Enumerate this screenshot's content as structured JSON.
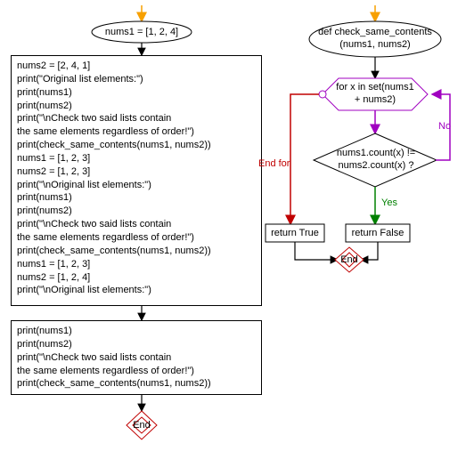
{
  "left": {
    "start_assign": "nums1 = [1, 2, 4]",
    "block1": "nums2 = [2, 4, 1]\nprint(\"Original list elements:\")\nprint(nums1)\nprint(nums2)\nprint(\"\\nCheck two said lists contain\nthe same elements regardless of order!\")\nprint(check_same_contents(nums1, nums2))\nnums1 = [1, 2, 3]\nnums2 = [1, 2, 3]\nprint(\"\\nOriginal list elements:\")\nprint(nums1)\nprint(nums2)\nprint(\"\\nCheck two said lists contain\nthe same elements regardless of order!\")\nprint(check_same_contents(nums1, nums2))\nnums1 = [1, 2, 3]\nnums2 = [1, 2, 4]\nprint(\"\\nOriginal list elements:\")",
    "block2": "print(nums1)\nprint(nums2)\nprint(\"\\nCheck two said lists contain\nthe same elements regardless of order!\")\nprint(check_same_contents(nums1, nums2))",
    "end": "End"
  },
  "right": {
    "func_def": "def check_same_contents\n(nums1, nums2)",
    "for_loop": "for x in set(nums1\n+ nums2)",
    "decision": "nums1.count(x) !=\nnums2.count(x) ?",
    "no": "No",
    "yes": "Yes",
    "end_for": "End for",
    "ret_true": "return True",
    "ret_false": "return False",
    "end": "End"
  },
  "colors": {
    "orange": "#f7a000",
    "purple": "#a000c0",
    "green": "#008000",
    "red": "#c00000",
    "black": "#000000"
  }
}
